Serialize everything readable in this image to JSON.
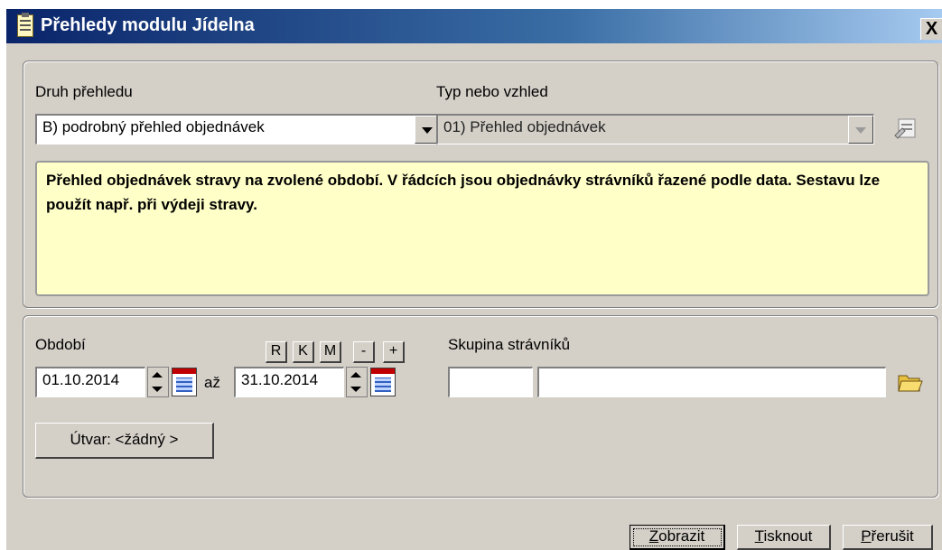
{
  "window": {
    "title": "Přehledy modulu Jídelna",
    "close_symbol": "X"
  },
  "report_section": {
    "kind_label": "Druh přehledu",
    "kind_value": "B) podrobný přehled objednávek",
    "type_label": "Typ nebo vzhled",
    "type_value": "01) Přehled objednávek",
    "description": "Přehled objednávek stravy na zvolené období. V řádcích jsou objednávky strávníků řazené podle data. Sestavu lze použít např. při výdeji stravy."
  },
  "period_section": {
    "period_label": "Období",
    "date_from": "01.10.2014",
    "to_label": "až",
    "date_to": "31.10.2014",
    "quick_buttons": [
      "R",
      "K",
      "M",
      "-",
      "+"
    ],
    "group_label": "Skupina strávníků",
    "group_code": "",
    "group_name": "",
    "unit_button": "Útvar: <žádný >"
  },
  "footer": {
    "show_first": "Z",
    "show_rest": "obrazit",
    "print_first": "T",
    "print_rest": "isknout",
    "cancel_first": "P",
    "cancel_rest": "řerušit"
  },
  "colors": {
    "title_start": "#0a246a",
    "title_end": "#a6caf0",
    "face": "#d4d0c8",
    "info_bg": "#ffffc8"
  }
}
